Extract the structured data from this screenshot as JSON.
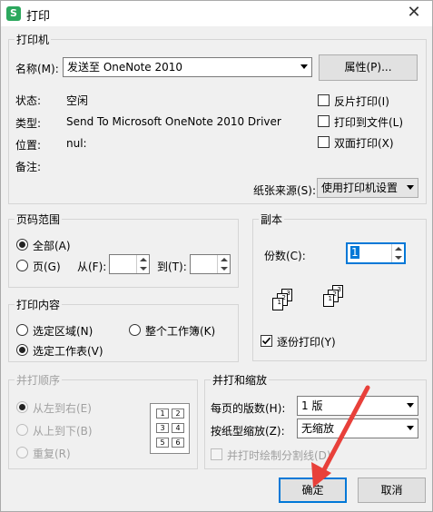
{
  "window": {
    "title": "打印",
    "app_icon": "S",
    "close_glyph": "✕"
  },
  "printer": {
    "group_label": "打印机",
    "name_label": "名称(M):",
    "name_value": "发送至 OneNote 2010",
    "properties_button": "属性(P)...",
    "status_label": "状态:",
    "status_value": "空闲",
    "type_label": "类型:",
    "type_value": "Send To Microsoft OneNote 2010 Driver",
    "location_label": "位置:",
    "location_value": "nul:",
    "comment_label": "备注:",
    "reverse_print": "反片打印(I)",
    "print_to_file": "打印到文件(L)",
    "duplex": "双面打印(X)",
    "paper_source_label": "纸张来源(S):",
    "paper_source_value": "使用打印机设置"
  },
  "page_range": {
    "group_label": "页码范围",
    "all": "全部(A)",
    "pages": "页(G)",
    "from_label": "从(F):",
    "to_label": "到(T):"
  },
  "copies": {
    "group_label": "副本",
    "count_label": "份数(C):",
    "count_value": "1",
    "collate": "逐份打印(Y)",
    "collate_icon_pages": [
      "1",
      "2",
      "3"
    ]
  },
  "print_content": {
    "group_label": "打印内容",
    "selection": "选定区域(N)",
    "workbook": "整个工作簿(K)",
    "sheet": "选定工作表(V)"
  },
  "print_order": {
    "group_label": "并打顺序",
    "left_to_right": "从左到右(E)",
    "top_to_bottom": "从上到下(B)",
    "repeat": "重复(R)",
    "grid_numbers": [
      "1",
      "2",
      "3",
      "4",
      "5",
      "6"
    ]
  },
  "zoom": {
    "group_label": "并打和缩放",
    "pages_per_sheet_label": "每页的版数(H):",
    "pages_per_sheet_value": "1 版",
    "scale_label": "按纸型缩放(Z):",
    "scale_value": "无缩放",
    "draw_dividers": "并打时绘制分割线(D)"
  },
  "buttons": {
    "ok": "确定",
    "cancel": "取消"
  },
  "colors": {
    "accent": "#0078d7",
    "annotation_arrow": "#e8403a"
  }
}
